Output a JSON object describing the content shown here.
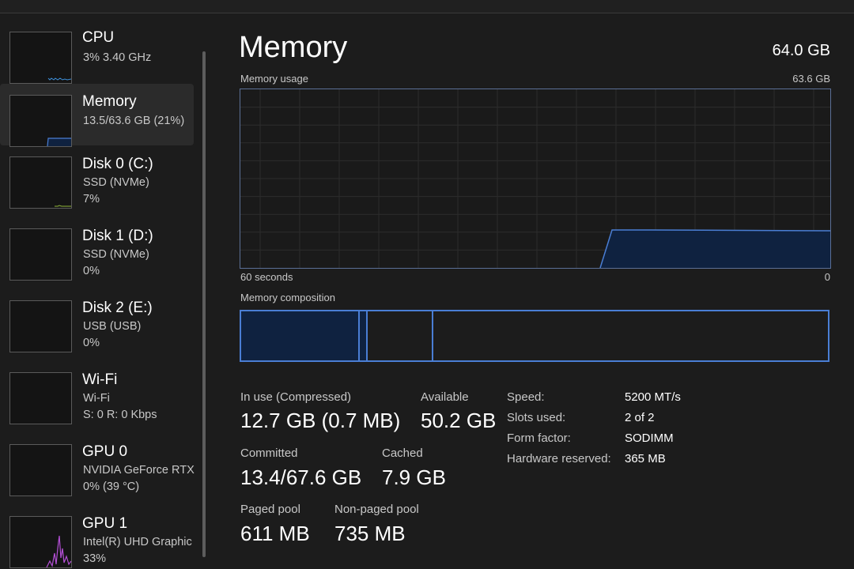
{
  "sidebar": {
    "items": [
      {
        "title": "CPU",
        "sub1": "3%  3.40 GHz",
        "sub2": ""
      },
      {
        "title": "Memory",
        "sub1": "13.5/63.6 GB (21%)",
        "sub2": ""
      },
      {
        "title": "Disk 0 (C:)",
        "sub1": "SSD (NVMe)",
        "sub2": "7%"
      },
      {
        "title": "Disk 1 (D:)",
        "sub1": "SSD (NVMe)",
        "sub2": "0%"
      },
      {
        "title": "Disk 2 (E:)",
        "sub1": "USB (USB)",
        "sub2": "0%"
      },
      {
        "title": "Wi-Fi",
        "sub1": "Wi-Fi",
        "sub2": "S: 0  R: 0 Kbps"
      },
      {
        "title": "GPU 0",
        "sub1": "NVIDIA GeForce RTX",
        "sub2": "0%  (39 °C)"
      },
      {
        "title": "GPU 1",
        "sub1": "Intel(R) UHD Graphic",
        "sub2": "33%"
      }
    ]
  },
  "main": {
    "title": "Memory",
    "total": "64.0 GB",
    "usage_label": "Memory usage",
    "usage_max": "63.6 GB",
    "time_label": "60 seconds",
    "time_zero": "0",
    "composition_label": "Memory composition",
    "stats": {
      "in_use_label": "In use (Compressed)",
      "in_use_value": "12.7 GB (0.7 MB)",
      "available_label": "Available",
      "available_value": "50.2 GB",
      "committed_label": "Committed",
      "committed_value": "13.4/67.6 GB",
      "cached_label": "Cached",
      "cached_value": "7.9 GB",
      "paged_label": "Paged pool",
      "paged_value": "611 MB",
      "nonpaged_label": "Non-paged pool",
      "nonpaged_value": "735 MB"
    },
    "specs": {
      "speed_label": "Speed:",
      "speed_value": "5200 MT/s",
      "slots_label": "Slots used:",
      "slots_value": "2 of 2",
      "form_label": "Form factor:",
      "form_value": "SODIMM",
      "reserved_label": "Hardware reserved:",
      "reserved_value": "365 MB"
    }
  },
  "colors": {
    "accent": "#4a7ed4",
    "graph_fill": "#0f2240",
    "cpu_line": "#3d8fd9",
    "disk_line": "#8fb339",
    "gpu_line": "#b44fd6"
  }
}
